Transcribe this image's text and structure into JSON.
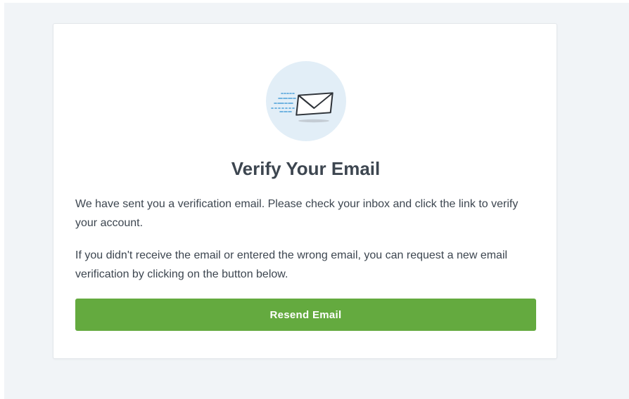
{
  "verify": {
    "icon": "sent-email-icon",
    "title": "Verify Your Email",
    "message": "We have sent you a verification email. Please check your inbox and click the link to verify your account.",
    "help_text": "If you didn't receive the email or entered the wrong email, you can request a new email verification by clicking on the button below.",
    "resend_button_label": "Resend Email"
  },
  "colors": {
    "page_background": "#f1f4f7",
    "card_background": "#ffffff",
    "icon_circle": "#e2eef7",
    "icon_speed_lines": "#4a9fd8",
    "text": "#3d4650",
    "button": "#64aa3f",
    "button_text": "#ffffff"
  }
}
